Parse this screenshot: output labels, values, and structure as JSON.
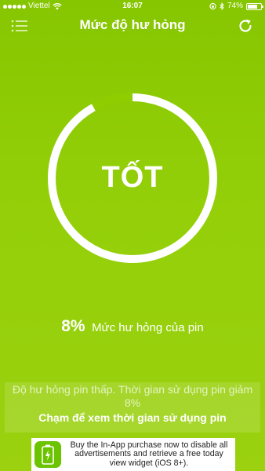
{
  "status_bar": {
    "carrier": "Viettel",
    "time": "16:07",
    "battery_percent_text": "74%",
    "battery_level": 0.74
  },
  "header": {
    "title": "Mức độ hư hỏng",
    "menu_icon": "menu-list-icon",
    "refresh_icon": "refresh-icon"
  },
  "gauge": {
    "status_text": "TỐT",
    "damage_fraction": 0.08
  },
  "damage": {
    "value": "8%",
    "label": "Mức hư hỏng của pin"
  },
  "info": {
    "message": "Độ hư hỏng pin thấp. Thời gian sử dụng pin giảm 8%",
    "cta": "Chạm để xem thời gian sử dụng pin"
  },
  "ad": {
    "text": "Buy the In-App purchase now to disable all advertisements and retrieve a free today view widget (iOS 8+).",
    "icon": "battery-app-icon"
  },
  "colors": {
    "background": "#8fcc00",
    "ring": "#ffffff",
    "text": "#ffffff"
  }
}
